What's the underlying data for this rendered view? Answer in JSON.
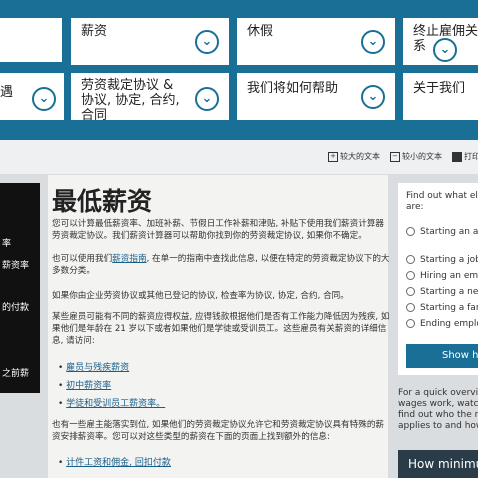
{
  "nav": {
    "tiles": [
      {
        "label": "",
        "arrow": ""
      },
      {
        "label": "薪资",
        "arrow": "⌄"
      },
      {
        "label": "休假",
        "arrow": "⌄"
      },
      {
        "label": "终止雇佣关系",
        "arrow": "⌄"
      },
      {
        "label": "遇",
        "arrow": "⌄"
      },
      {
        "label": "劳资裁定协议 & 协议, 协定, 合约, 合同",
        "arrow": "⌄"
      },
      {
        "label": "我们将如何帮助",
        "arrow": "⌄"
      },
      {
        "label": "关于我们",
        "arrow": ""
      }
    ]
  },
  "toolbar": {
    "larger_text": "较大的文本",
    "smaller_text": "较小的文本",
    "print": "打印"
  },
  "sidebar": {
    "items": [
      "率",
      "薪资率",
      "的付款",
      "之前薪"
    ]
  },
  "main": {
    "title": "最低薪资",
    "p1": "您可以计算最低薪资率、加班补薪、节假日工作补薪和津贴, 补贴下使用我们薪资计算器劳资裁定协议。我们薪资计算器可以帮助你找到你的劳资裁定协议, 如果你不确定。",
    "p2_prefix": "也可以使用我们",
    "p2_link": "薪资指南",
    "p2_suffix": ", 在单一的指南中查找此信息, 以便在特定的劳资裁定协议下的大多数分类。",
    "p3": "如果你由企业劳资协议或其他已登记的协议, 检查率为协议, 协定, 合约, 合同。",
    "p4": "某些雇员可能有不同的薪资应得权益, 应得钱款根据他们是否有工作能力降低因为残疾, 如果他们是年龄在 21 岁以下或者如果他们是学徒或受训员工。这些雇员有关薪资的详细信息, 请访问:",
    "bullets": [
      "雇员与残疾薪资",
      "初中薪资率",
      "学徒和受训员工薪资率。"
    ],
    "p5": "也有一些雇主能落实到位, 如果他们的劳资裁定协议允许它和劳资裁定协议具有特殊的薪资安排薪资率。您可以对这些类型的薪资在下面的页面上找到额外的信息:",
    "bullets2": [
      "计件工资和佣金, 回扣付款"
    ]
  },
  "right": {
    "title": "Find out what else if you are:",
    "options": [
      "Starting an apprenticeship or traineeship",
      "Starting a job",
      "Hiring an employee",
      "Starting a new business",
      "Starting a family",
      "Ending employment"
    ],
    "show_button": "Show help",
    "text_lines": [
      "For a quick overview of",
      "wages work, watch our",
      "find out who the national",
      "applies to and how c"
    ],
    "dark_box": "How minimum wages"
  }
}
